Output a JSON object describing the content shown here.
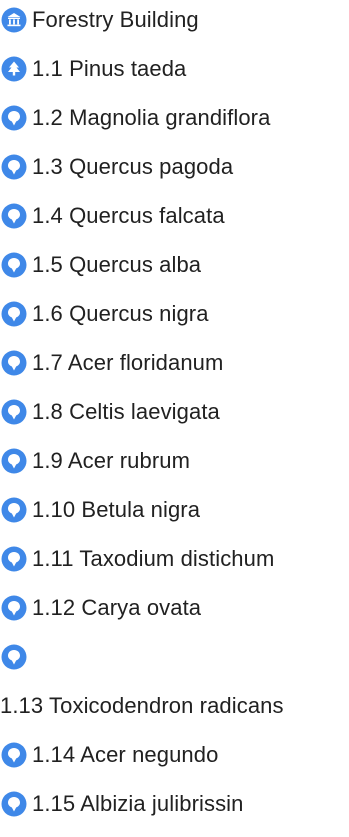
{
  "colors": {
    "marker_blue": "#3f88e8",
    "text": "#212121"
  },
  "list": {
    "items": [
      {
        "icon": "building-icon",
        "label": "Forestry Building"
      },
      {
        "icon": "tree-marker-icon",
        "label": "1.1 Pinus taeda"
      },
      {
        "icon": "map-marker-icon",
        "label": "1.2 Magnolia grandiflora"
      },
      {
        "icon": "map-marker-icon",
        "label": "1.3 Quercus pagoda"
      },
      {
        "icon": "map-marker-icon",
        "label": "1.4 Quercus falcata"
      },
      {
        "icon": "map-marker-icon",
        "label": "1.5 Quercus alba"
      },
      {
        "icon": "map-marker-icon",
        "label": "1.6 Quercus nigra"
      },
      {
        "icon": "map-marker-icon",
        "label": "1.7 Acer floridanum"
      },
      {
        "icon": "map-marker-icon",
        "label": "1.8 Celtis laevigata"
      },
      {
        "icon": "map-marker-icon",
        "label": "1.9 Acer rubrum"
      },
      {
        "icon": "map-marker-icon",
        "label": "1.10 Betula nigra"
      },
      {
        "icon": "map-marker-icon",
        "label": "1.11 Taxodium distichum"
      },
      {
        "icon": "map-marker-icon",
        "label": "1.12 Carya ovata"
      },
      {
        "icon": "map-marker-icon",
        "label": ""
      },
      {
        "icon": "",
        "label": "1.13 Toxicodendron radicans"
      },
      {
        "icon": "map-marker-icon",
        "label": "1.14 Acer negundo"
      },
      {
        "icon": "map-marker-icon",
        "label": "1.15 Albizia julibrissin"
      }
    ]
  }
}
